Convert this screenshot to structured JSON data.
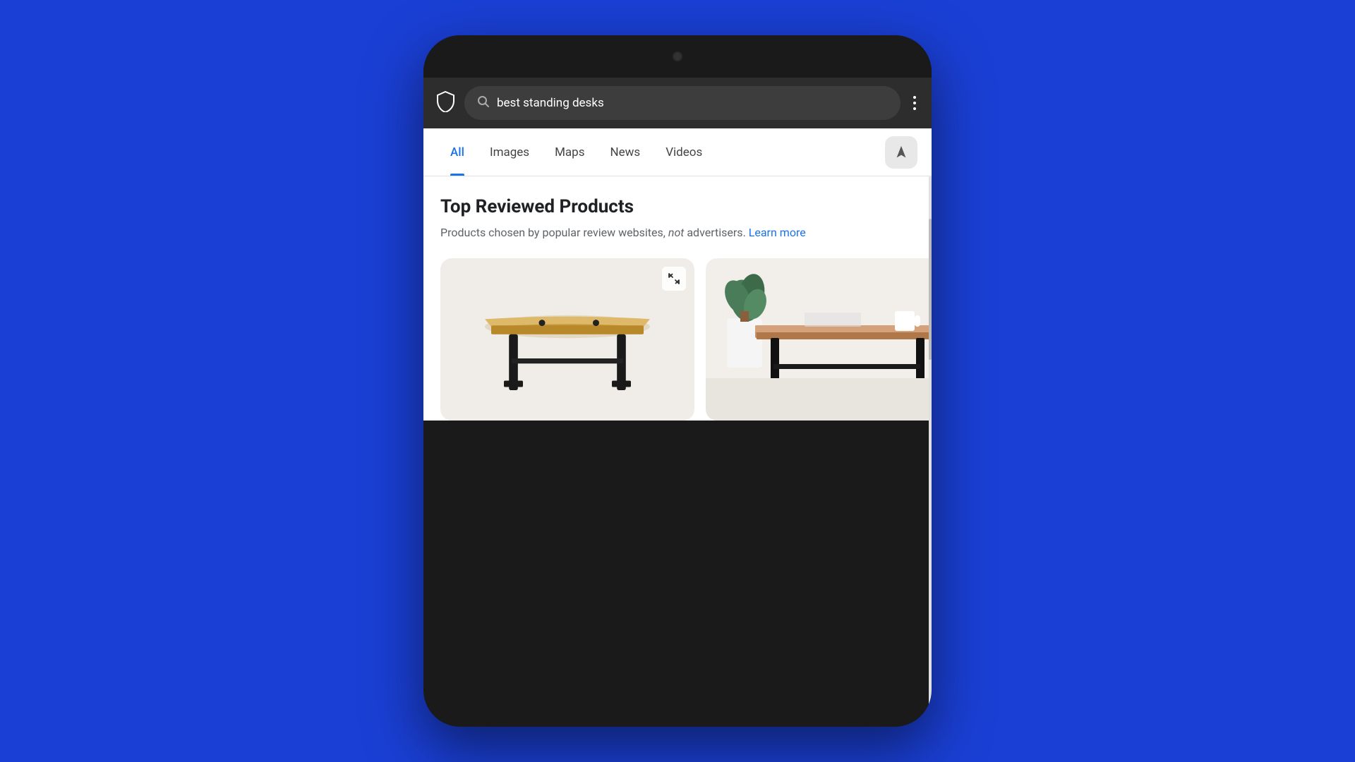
{
  "background_color": "#1a3fd4",
  "phone": {
    "browser": {
      "search_query": "best standing desks",
      "search_placeholder": "Search",
      "more_menu_label": "More options"
    },
    "tabs": [
      {
        "label": "All",
        "active": true
      },
      {
        "label": "Images",
        "active": false
      },
      {
        "label": "Maps",
        "active": false
      },
      {
        "label": "News",
        "active": false
      },
      {
        "label": "Videos",
        "active": false
      }
    ],
    "location_button_label": "Location",
    "content": {
      "section_title": "Top Reviewed Products",
      "section_subtitle_1": "Products chosen by popular review websites, ",
      "section_subtitle_em": "not",
      "section_subtitle_2": " advertisers.",
      "learn_more_label": "Learn more",
      "products": [
        {
          "id": "product-1",
          "alt": "Standing desk with natural wood top and black legs"
        },
        {
          "id": "product-2",
          "alt": "Standing desk with wood top, black frame, plant and white cup"
        }
      ]
    }
  }
}
